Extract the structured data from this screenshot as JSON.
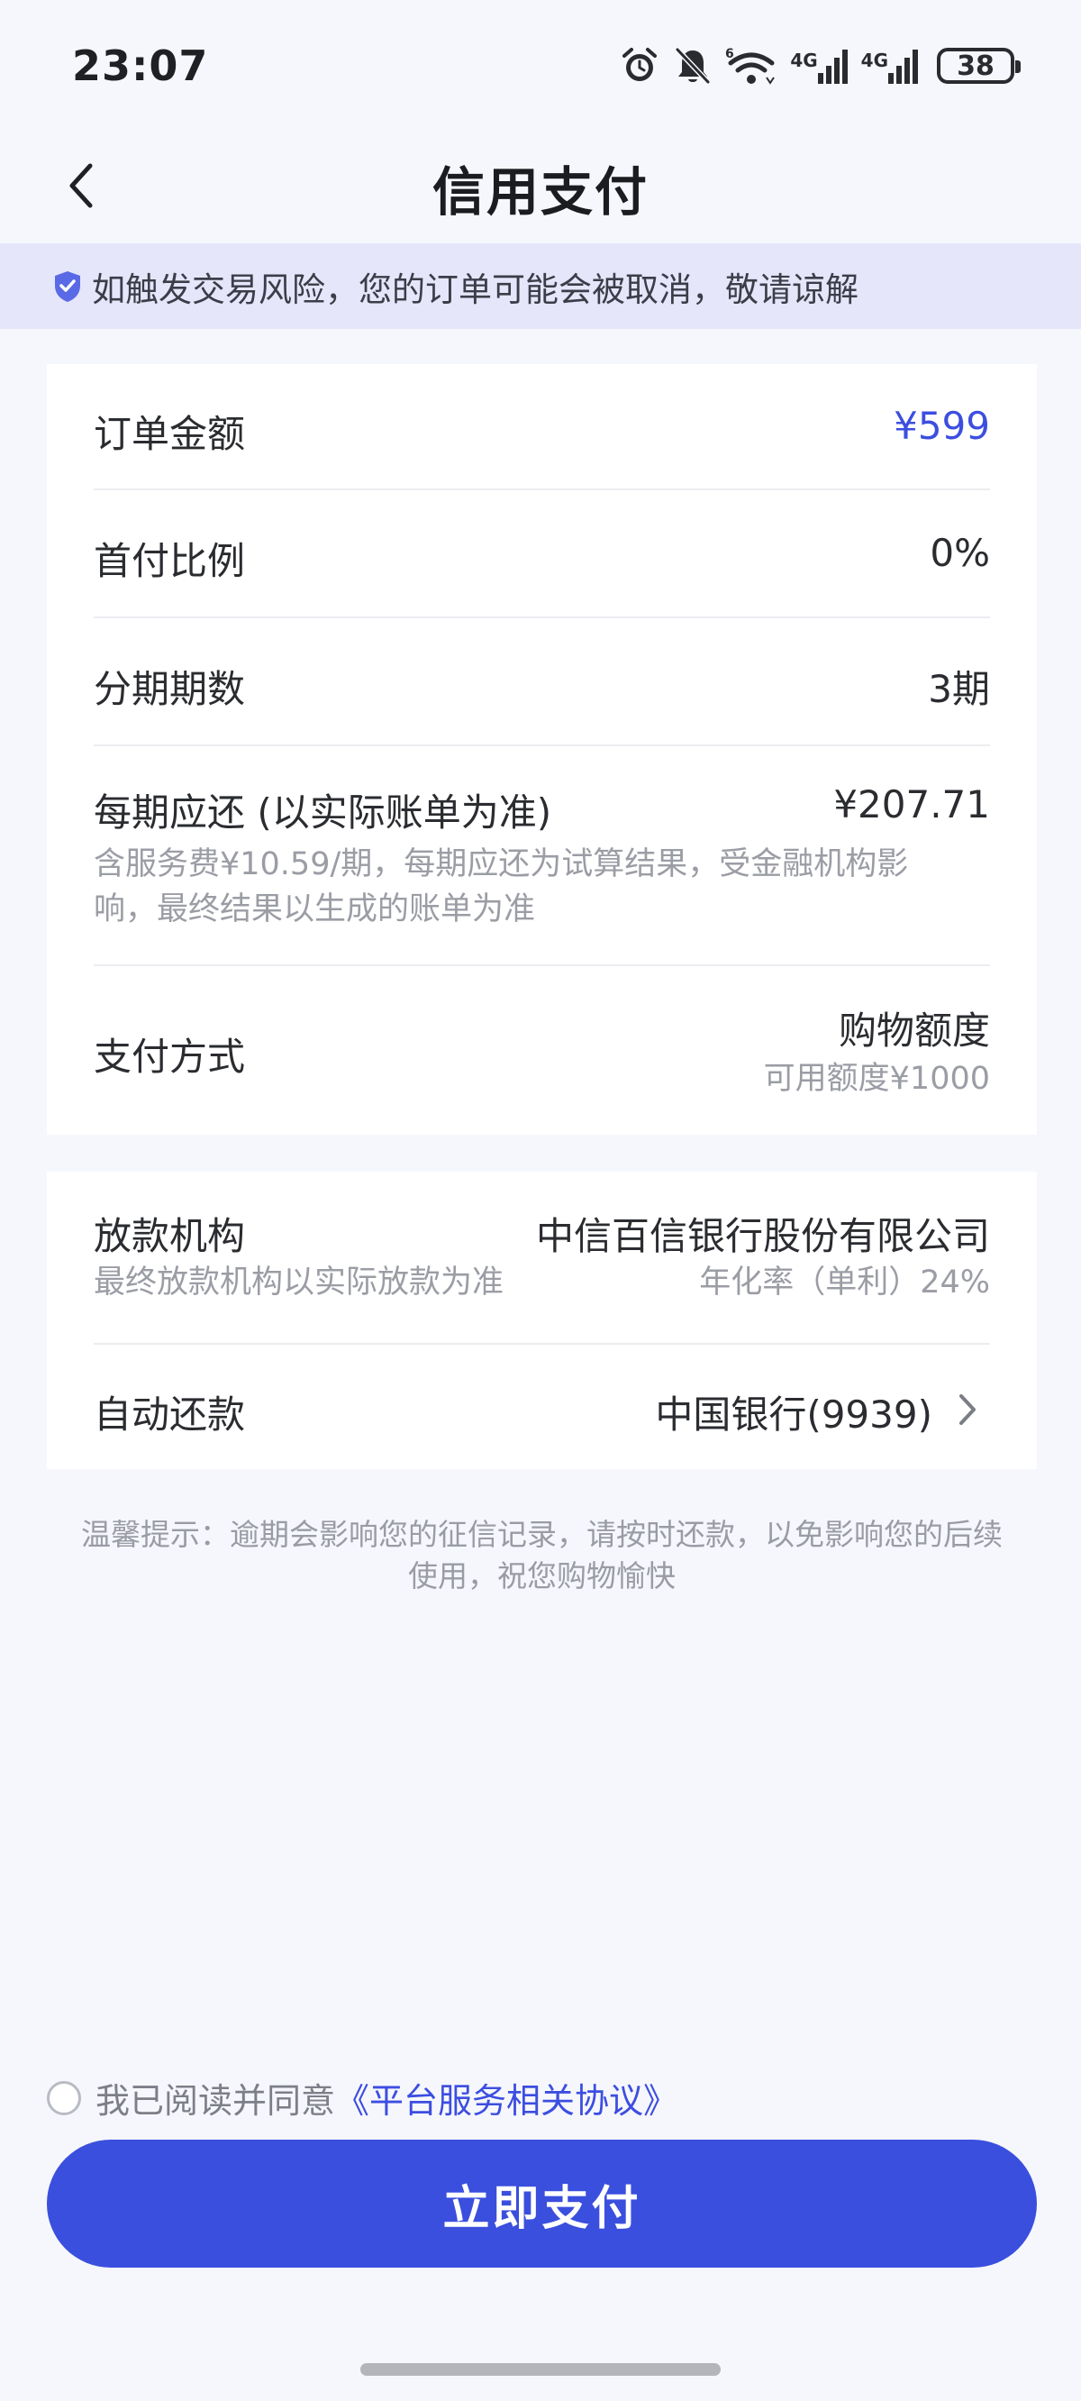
{
  "status_bar": {
    "time": "23:07",
    "network_1": "4G",
    "network_2": "4G",
    "battery": "38"
  },
  "nav": {
    "title": "信用支付"
  },
  "notice": {
    "text": "如触发交易风险，您的订单可能会被取消，敬请谅解"
  },
  "order": {
    "amount_label": "订单金额",
    "amount_value": "¥599",
    "down_payment_label": "首付比例",
    "down_payment_value": "0%",
    "installments_label": "分期期数",
    "installments_value": "3期",
    "per_period_label": "每期应还 (以实际账单为准)",
    "per_period_value": "¥207.71",
    "per_period_note_line1": "含服务费¥10.59/期，每期应还为试算结果，受金融机构影",
    "per_period_note_line2": "响，最终结果以生成的账单为准",
    "pay_method_label": "支付方式",
    "pay_method_value": "购物额度",
    "pay_method_sub": "可用额度¥1000"
  },
  "lender": {
    "label": "放款机构",
    "value": "中信百信银行股份有限公司",
    "sub_left": "最终放款机构以实际放款为准",
    "sub_right": "年化率（单利）24%",
    "auto_repay_label": "自动还款",
    "auto_repay_value": "中国银行(9939)"
  },
  "tip": {
    "line1": "温馨提示：逾期会影响您的征信记录，请按时还款，以免影响您的后续",
    "line2": "使用，祝您购物愉快"
  },
  "agreement": {
    "prefix": "我已阅读并同意",
    "link": "《平台服务相关协议》",
    "checked": false
  },
  "pay_button": {
    "label": "立即支付"
  },
  "colors": {
    "accent": "#3a4fde",
    "notice_bg": "#e5e6fa",
    "page_bg": "#f6f7fc"
  },
  "icons": {
    "notice": "shield-check-icon",
    "back": "chevron-left-icon",
    "auto_repay": "chevron-right-icon"
  }
}
